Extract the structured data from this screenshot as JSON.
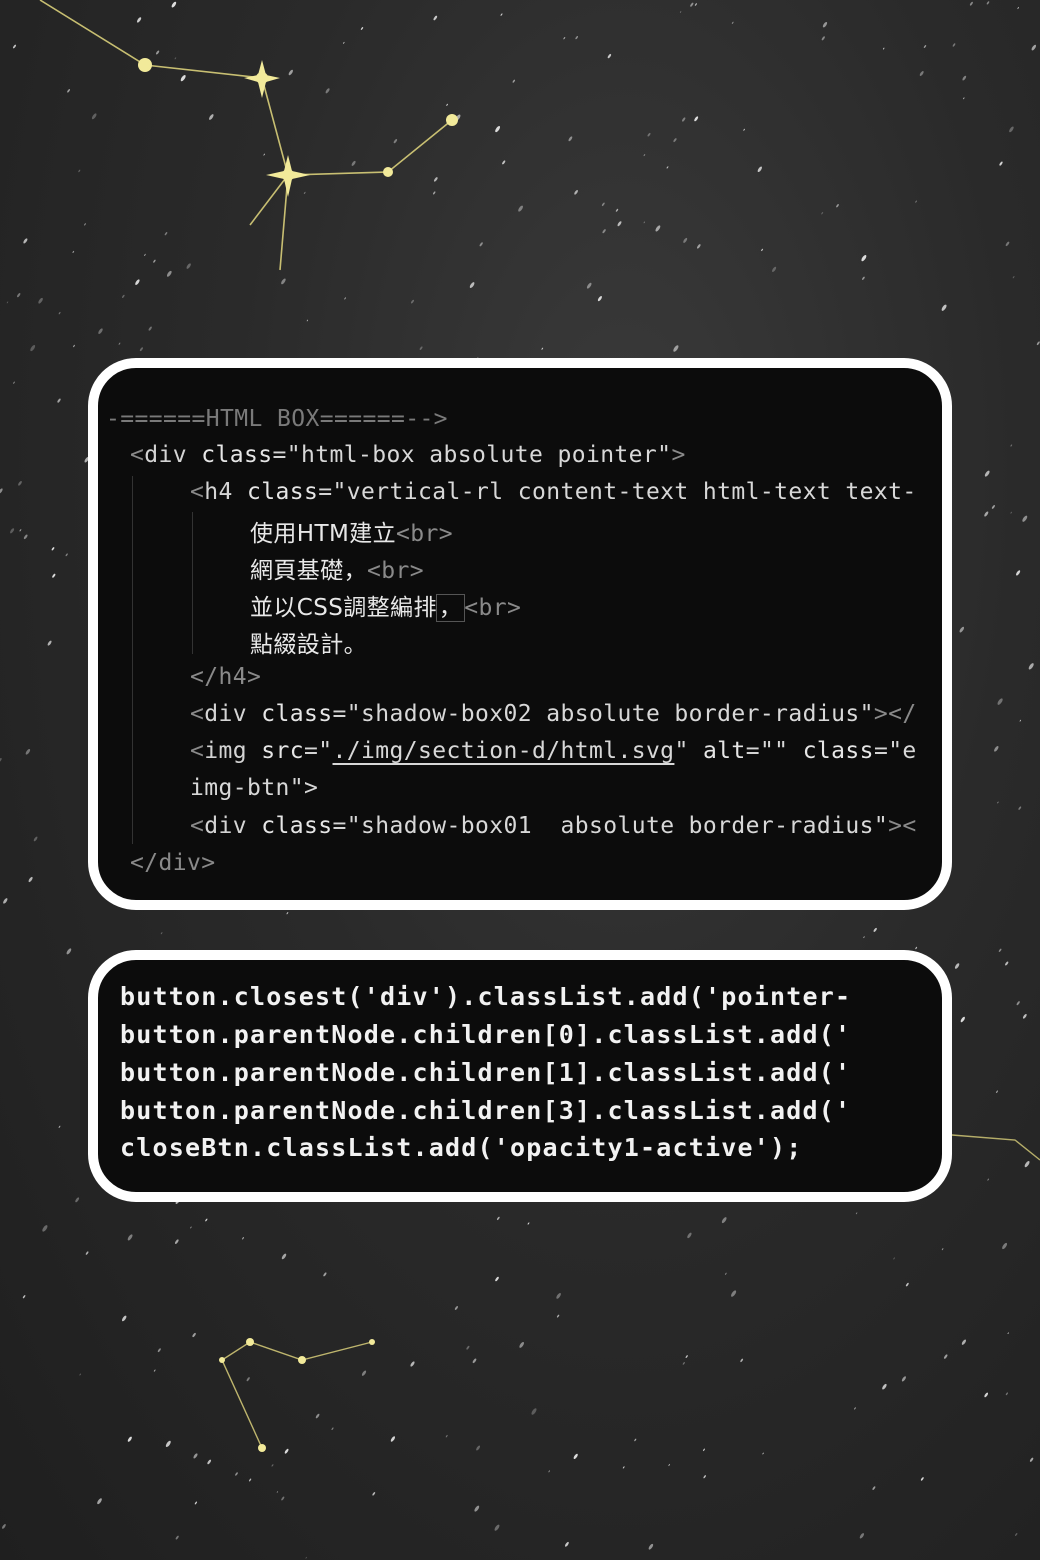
{
  "html_box": {
    "comment": "-======HTML BOX======-->",
    "div_open": {
      "lt": "<",
      "name": "div ",
      "attr": "class",
      "eq": "=",
      "value": "\"html-box absolute pointer\"",
      "gt": ">"
    },
    "h4_open": {
      "lt": "<",
      "name": "h4 ",
      "attr": "class",
      "eq": "=",
      "value": "\"vertical-rl content-text html-text text-"
    },
    "text_lines": [
      {
        "zh": "使用HTM建立",
        "br": "<br>"
      },
      {
        "zh": "網頁基礎，",
        "br": "<br>"
      },
      {
        "zh": "並以CSS調整編排",
        "punct": "，",
        "br": "<br>"
      },
      {
        "zh": "點綴設計。",
        "br": ""
      }
    ],
    "h4_close": "</h4>",
    "shadow02": {
      "lt": "<",
      "name": "div ",
      "attr": "class",
      "eq": "=",
      "value": "\"shadow-box02 absolute border-radius\"",
      "tail": "></"
    },
    "img_line": {
      "lt": "<",
      "name": "img ",
      "attr1": "src",
      "eq1": "=",
      "q1": "\"",
      "src": "./img/section-d/html.svg",
      "q2": "\" ",
      "attr2": "alt",
      "eq2": "=",
      "v2": "\"\" ",
      "attr3": "class",
      "eq3": "=",
      "v3": "\"e"
    },
    "img_cont": "img-btn\">",
    "shadow01": {
      "lt": "<",
      "name": "div ",
      "attr": "class",
      "eq": "=",
      "value": "\"shadow-box01  absolute border-radius\"",
      "tail": "><"
    },
    "div_close": "</div>"
  },
  "js_box": {
    "lines": [
      "button.closest('div').classList.add('pointer-",
      "button.parentNode.children[0].classList.add('",
      "button.parentNode.children[1].classList.add('",
      "button.parentNode.children[3].classList.add('",
      "closeBtn.classList.add('opacity1-active');"
    ]
  },
  "colors": {
    "background": "#2a2a2a",
    "card_border": "#ffffff",
    "card_bg": "#0c0c0c",
    "constellation": "#e8e08a"
  }
}
